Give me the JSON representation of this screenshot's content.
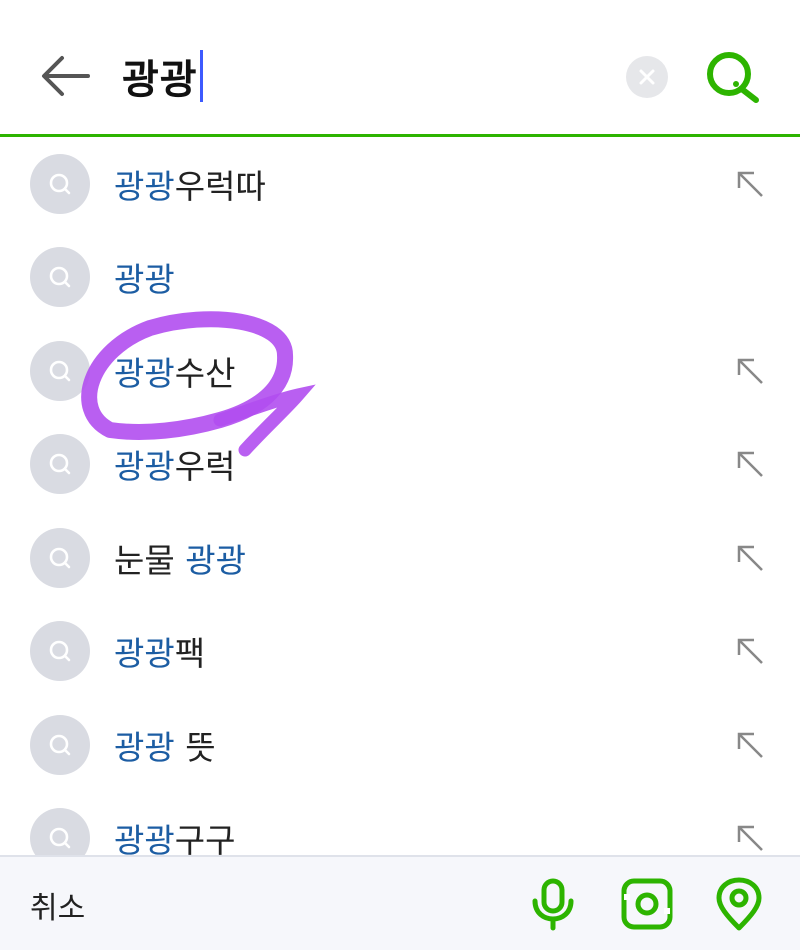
{
  "search": {
    "query": "광광"
  },
  "suggestions": [
    {
      "highlight": "광광",
      "rest": "우럭따",
      "arrow": true
    },
    {
      "highlight": "광광",
      "rest": "",
      "arrow": false
    },
    {
      "highlight": "광광",
      "rest": "수산",
      "arrow": true
    },
    {
      "highlight": "광광",
      "rest": "우럭",
      "arrow": true
    },
    {
      "prefix": "눈물 ",
      "highlight": "광광",
      "rest": "",
      "arrow": true
    },
    {
      "highlight": "광광",
      "rest": "팩",
      "arrow": true
    },
    {
      "highlight": "광광",
      "rest": " 뜻",
      "arrow": true
    },
    {
      "highlight": "광광",
      "rest": "구구",
      "arrow": true
    }
  ],
  "bottom_bar": {
    "cancel_label": "취소"
  },
  "colors": {
    "accent": "#2db400",
    "highlight_text": "#1c5da3",
    "annotation": "#b14ef0"
  },
  "icons": [
    "back-arrow-icon",
    "clear-icon",
    "search-icon",
    "suggestion-search-icon",
    "fill-query-arrow-icon",
    "microphone-icon",
    "camera-lens-icon",
    "location-pin-icon"
  ]
}
